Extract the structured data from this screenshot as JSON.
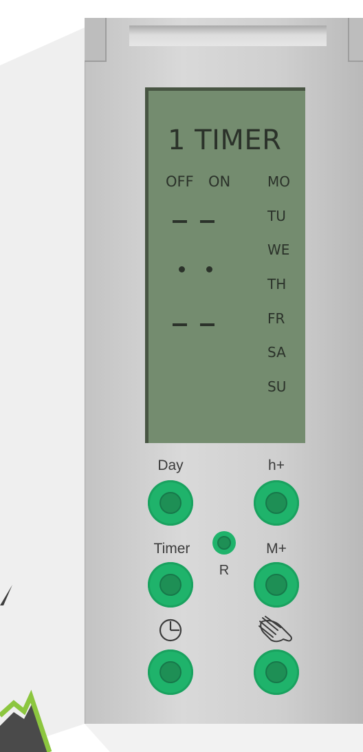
{
  "display": {
    "title": "1 TIMER",
    "off_label": "OFF",
    "on_label": "ON",
    "days": [
      "MO",
      "TU",
      "WE",
      "TH",
      "FR",
      "SA",
      "SU"
    ]
  },
  "buttons": {
    "day": "Day",
    "hour_plus": "h+",
    "timer": "Timer",
    "minute_plus": "M+",
    "reset": "R"
  },
  "icons": {
    "clock": "clock-icon",
    "manual": "hand-icon"
  },
  "colors": {
    "lcd": "#748c6f",
    "button": "#1fb36b",
    "button_inner": "#1e8f55"
  }
}
